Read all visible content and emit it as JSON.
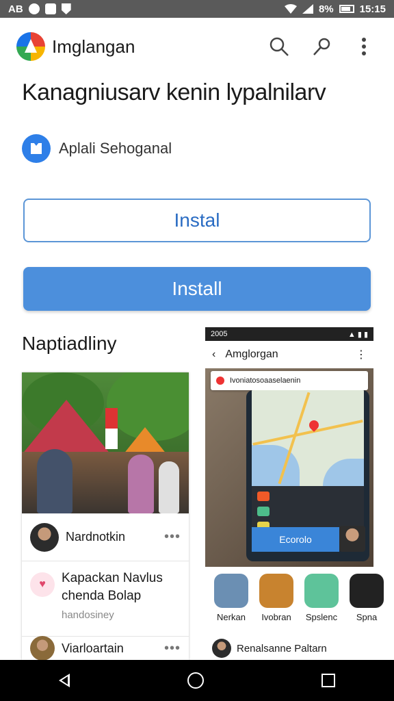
{
  "status_bar": {
    "left_text": "AB",
    "battery": "8%",
    "time": "15:15"
  },
  "app_bar": {
    "app_name": "Imglangan",
    "icons": [
      "search-icon",
      "pin-icon",
      "more-vert-icon"
    ]
  },
  "headline": "Kanagniusarv kenin lypalnilarv",
  "subheader": {
    "icon": "bookmark-icon",
    "text": "Aplali Sehoganal"
  },
  "buttons": {
    "outline_label": "Instal",
    "filled_label": "Install"
  },
  "section": {
    "title": "Naptiadliny"
  },
  "left_card": {
    "photo_icon": "event-photo",
    "author": "Nardnotkin",
    "post": {
      "title": "Kapackan Navlus chenda Bolap",
      "meta": "handosiney"
    },
    "bottom_author": "Viarloartain"
  },
  "right_card": {
    "status_time": "2005",
    "app_title": "Amglorgan",
    "notification": "Ivoniatosoaaselaenin",
    "button_label": "Ecorolo"
  },
  "apps": [
    {
      "label": "Nerkan",
      "color": "#6b8fb3"
    },
    {
      "label": "Ivobran",
      "color": "#c8832f"
    },
    {
      "label": "Spslenc",
      "color": "#5ec39a"
    },
    {
      "label": "Spna",
      "color": "#222222"
    }
  ],
  "suggestion": {
    "text": "Renalsanne Paltarn"
  },
  "colors": {
    "accent": "#4c8fdc",
    "outline": "#5b95d6",
    "statusbar": "#5a5a5a"
  }
}
